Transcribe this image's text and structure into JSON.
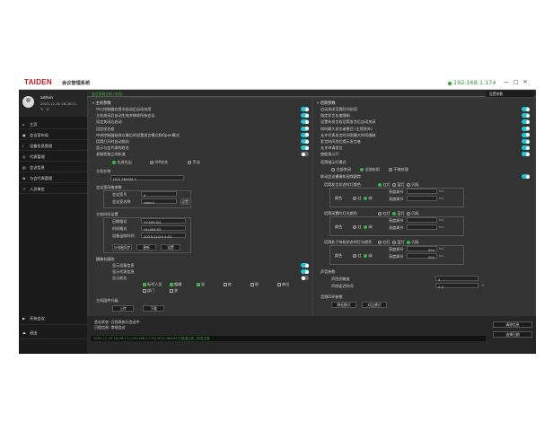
{
  "window": {
    "logo": "TAIDEN",
    "title": "会议管理系统",
    "ip": "192.168.1.174",
    "controls": [
      "—",
      "□",
      "✕"
    ]
  },
  "user": {
    "name": "admin",
    "datetime": "2023-12-20 16:28:11",
    "icons": [
      "edit-icon",
      "logout-icon"
    ]
  },
  "sidebar": {
    "items": [
      {
        "icon": "⌂",
        "label": "主页"
      },
      {
        "icon": "▣",
        "label": "会议室布局"
      },
      {
        "icon": "ⅰ",
        "label": "设备信息管理"
      },
      {
        "icon": "◎",
        "label": "代表管理"
      },
      {
        "icon": "▤",
        "label": "会议信息"
      },
      {
        "icon": "✿",
        "label": "与会代表管理"
      },
      {
        "icon": "⚇",
        "label": "人员审定"
      }
    ],
    "bottom": [
      {
        "icon": "▶",
        "label": "开始会议"
      },
      {
        "icon": "⏏",
        "label": "退出"
      }
    ]
  },
  "subbar": {
    "tag": "会议系统主机 (在线)",
    "settings_label": "设置参数"
  },
  "left": {
    "section_title": "主机参数",
    "toggles": [
      {
        "label": "中心控制器在首次启动后自动启用",
        "on": true
      },
      {
        "label": "主机关闭后自动生效并移除所有会议",
        "on": true
      },
      {
        "label": "设定关闭后启动",
        "on": true
      },
      {
        "label": "设定优先权",
        "on": true
      },
      {
        "label": "中央控制器始终以最后的设置发言模式和Open模式",
        "on": true
      },
      {
        "label": "话筒打开时自动指向",
        "on": true
      },
      {
        "label": "显示与会代表的姓名",
        "on": true
      },
      {
        "label": "录制到独立的轨道",
        "on": false
      }
    ],
    "mode_options": [
      "先进先出",
      "VIP优先",
      "手动"
    ],
    "mode_selected": 0,
    "host_name_label": "主机名称",
    "host_name_value": "HCS-3600M-1",
    "network_title": "会议室网络参数",
    "net_fields": [
      {
        "label": "会议室号",
        "value": "0"
      },
      {
        "label": "会议室名称",
        "value": "room1"
      }
    ],
    "net_btn": "设置",
    "time_title": "主机时间设置",
    "time_fields": [
      {
        "label": "日期格式",
        "value": "YY-MM-DD"
      },
      {
        "label": "时间格式",
        "value": "HH:MM:SS"
      },
      {
        "label": "设备当前时间",
        "value": "2023/12/20 4:52"
      }
    ],
    "time_buttons": [
      "与电脑同步",
      "更新",
      "设置"
    ],
    "addr_title": "摄像机跟踪",
    "addr_toggles": [
      {
        "label": "显示设备信息",
        "on": true
      },
      {
        "label": "显示代表信息",
        "on": true
      },
      {
        "label": "显示姓名",
        "on": false
      }
    ],
    "check_row1": [
      "标代人员",
      "编辑",
      "显",
      "姓",
      "职",
      "单位"
    ],
    "check_row2": [
      "部门",
      "关"
    ],
    "upgrade_title": "主机固件升级",
    "upgrade_buttons": [
      "上传",
      "下载"
    ]
  },
  "right": {
    "section_title": "话筒参数",
    "toggles": [
      {
        "label": "自动关闭话筒时间启用",
        "on": true
      },
      {
        "label": "指定发言长度限制",
        "on": true
      },
      {
        "label": "设置有发言权话筒发言后自动关闭",
        "on": true
      },
      {
        "label": "同时最大发言者数目 (主席除外)",
        "on": true
      },
      {
        "label": "允许代表发言时间到最大时间限制",
        "on": true
      },
      {
        "label": "发言时间到后提示发言者",
        "on": true
      },
      {
        "label": "允许申请发言",
        "on": true
      },
      {
        "label": "使能指示灯",
        "on": true
      }
    ],
    "mic_title": "话筒指示灯模式",
    "mic_options": [
      "全部关闭",
      "全部启用",
      "不做处理"
    ],
    "mic_selected": 1,
    "link_toggle": "联动会议摄像机视频跟踪",
    "color_groups": [
      {
        "label": "话筒发言状态时灯颜色",
        "options": [
          "红灯",
          "蓝灯",
          "闪烁"
        ],
        "selected": 0,
        "sub": "颜色",
        "subopts": [
          "红",
          "绿"
        ],
        "extra": [
          "亮度调节",
          "亮度调节"
        ]
      },
      {
        "label": "话筒闲置时灯光颜色",
        "options": [
          "红灯",
          "蓝灯",
          "闪烁"
        ],
        "selected": 1,
        "sub": "颜色",
        "subopts": [
          "红",
          "绿"
        ],
        "extra": [
          "亮度调节",
          "亮度调节"
        ]
      },
      {
        "label": "话筒处于待机状态时灯光颜色",
        "options": [
          "红灯",
          "蓝灯",
          "闪烁"
        ],
        "selected": 2,
        "sub": "颜色",
        "subopts": [
          "红",
          "绿"
        ],
        "extra": [
          "亮度调节",
          "亮度调节"
        ]
      }
    ],
    "bright_values": [
      "500",
      "500"
    ],
    "unit": "ms",
    "voice_title": "声音参数",
    "voice_fields": [
      {
        "label": "声控灵敏度",
        "value": "5"
      },
      {
        "label": "声控延迟时间",
        "value": "0.3"
      }
    ],
    "voice_unit": "S",
    "dsp_title": "音频DSP参数",
    "dsp_buttons": [
      "降低模式",
      "对比模式"
    ]
  },
  "log": {
    "line1": "会议状态: 日程表执行会议中",
    "line2": "日程信息: 常规会议",
    "message": "2023-12-20 16:28:11  [192.168.1.174]  HCS-3600M  已连接主机, 状态正常",
    "buttons": [
      "清除信息",
      "选择日期"
    ]
  },
  "colors": {
    "accent": "#27c3d4",
    "ok": "#30b84a",
    "brand": "#c8161d"
  }
}
